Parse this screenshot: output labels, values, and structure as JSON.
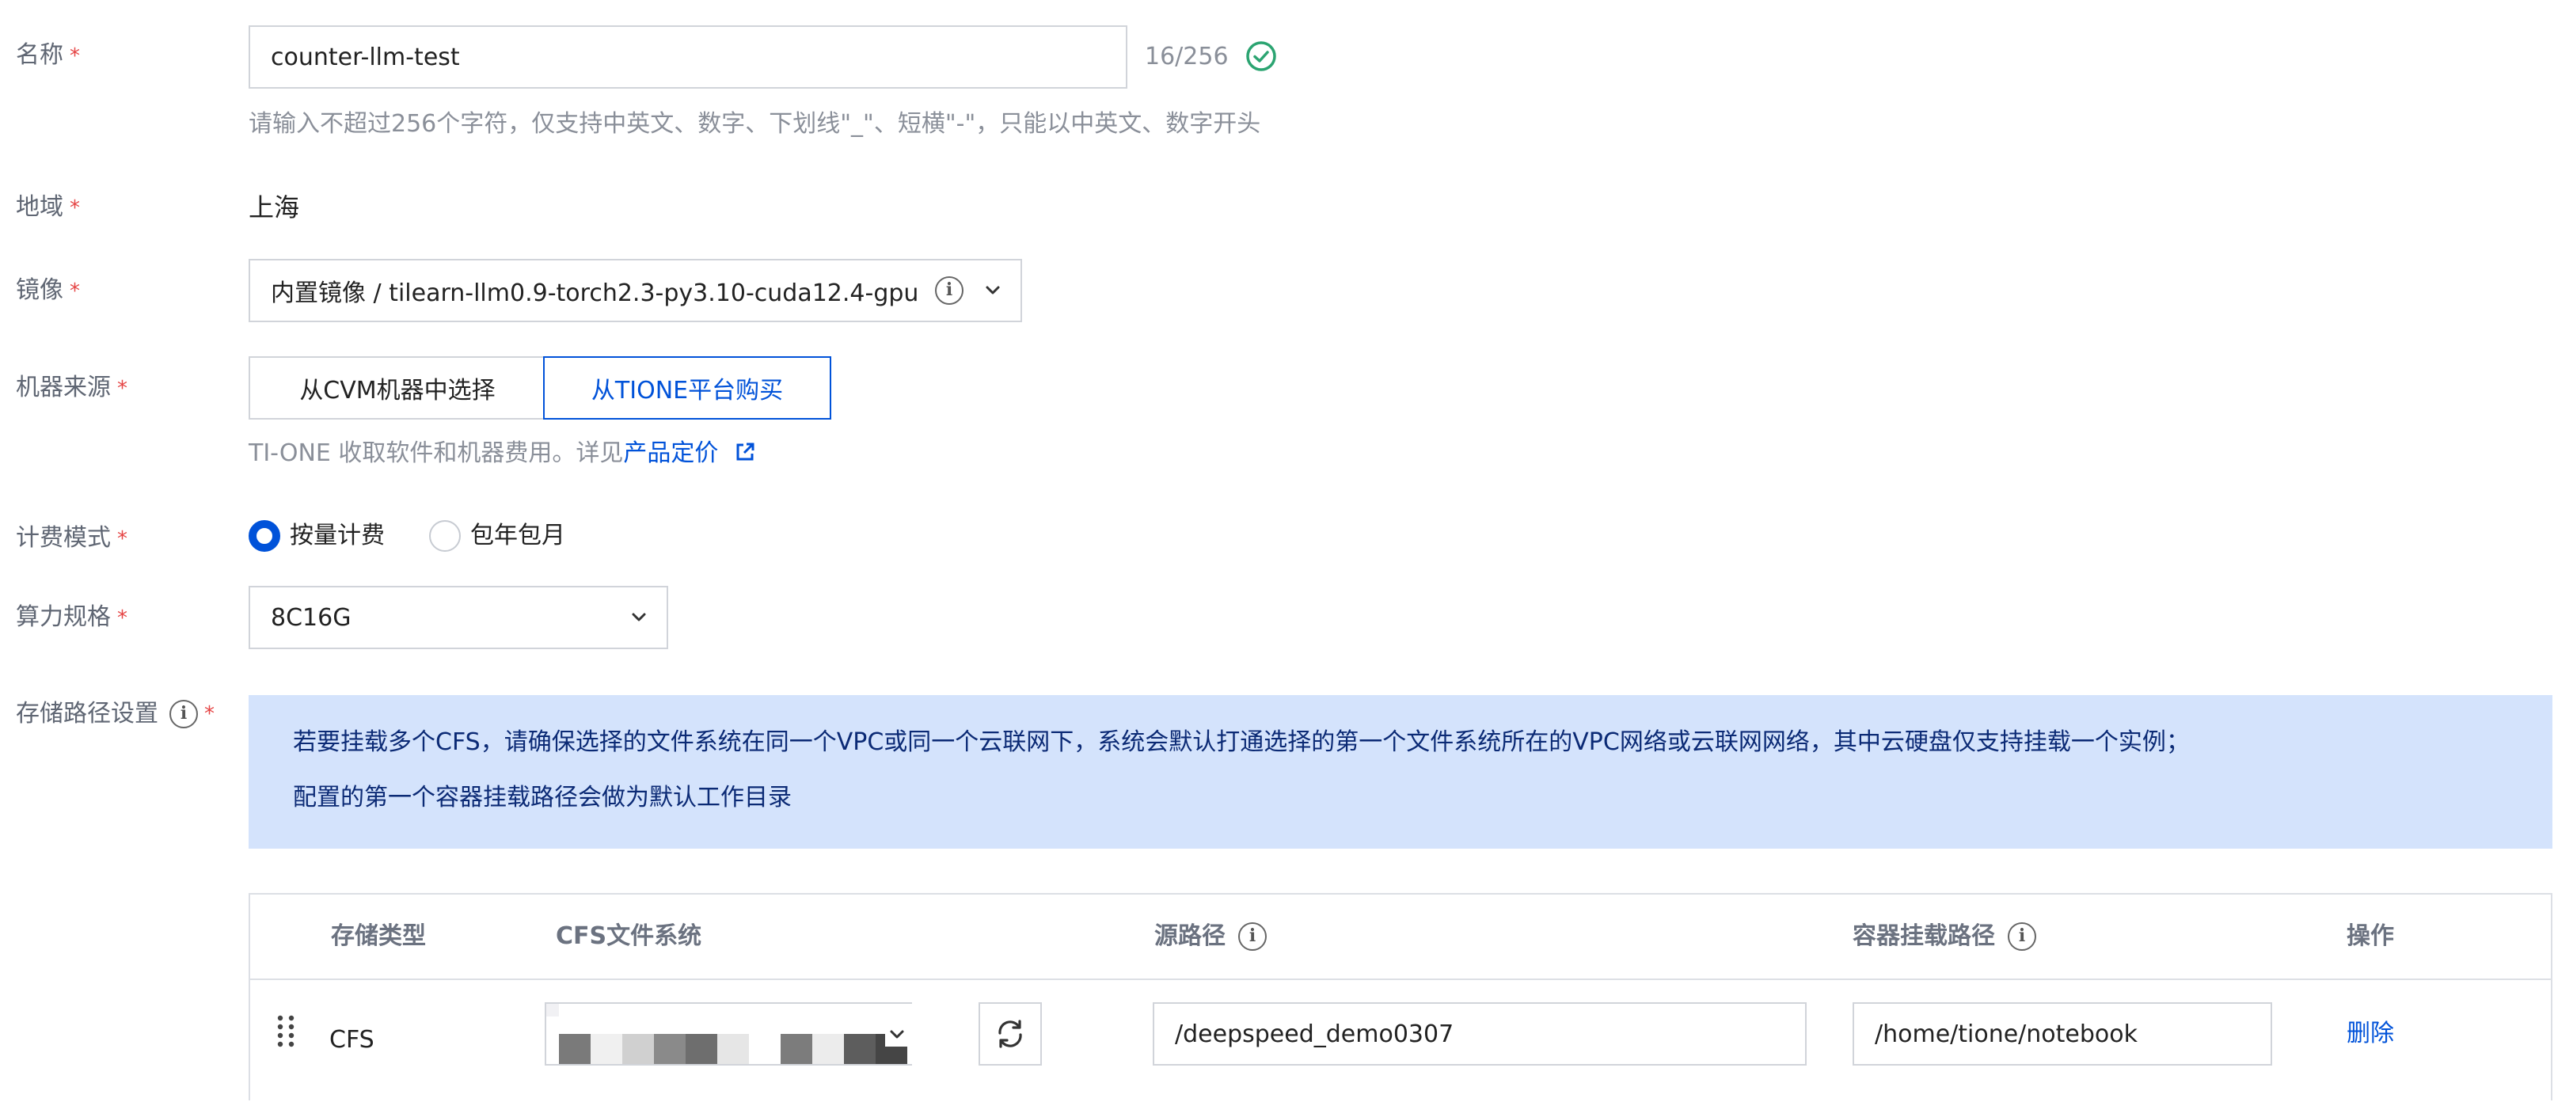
{
  "form": {
    "name": {
      "label": "名称",
      "required_mark": "*",
      "value": "counter-llm-test",
      "counter": "16/256",
      "hint": "请输入不超过256个字符，仅支持中英文、数字、下划线\"_\"、短横\"-\"，只能以中英文、数字开头"
    },
    "region": {
      "label": "地域",
      "required_mark": "*",
      "value": "上海"
    },
    "image": {
      "label": "镜像",
      "required_mark": "*",
      "value": "内置镜像 / tilearn-llm0.9-torch2.3-py3.10-cuda12.4-gpu"
    },
    "machine_source": {
      "label": "机器来源",
      "required_mark": "*",
      "options": [
        "从CVM机器中选择",
        "从TIONE平台购买"
      ],
      "selected": "从TIONE平台购买",
      "hint_prefix": "TI-ONE 收取软件和机器费用。详见",
      "hint_link": "产品定价"
    },
    "billing": {
      "label": "计费模式",
      "required_mark": "*",
      "options": [
        "按量计费",
        "包年包月"
      ],
      "selected": "按量计费"
    },
    "spec": {
      "label": "算力规格",
      "required_mark": "*",
      "value": "8C16G"
    },
    "storage": {
      "label": "存储路径设置",
      "required_mark": "*",
      "notice_line1": "若要挂载多个CFS，请确保选择的文件系统在同一个VPC或同一个云联网下，系统会默认打通选择的第一个文件系统所在的VPC网络或云联网网络，其中云硬盘仅支持挂载一个实例；",
      "notice_line2": "配置的第一个容器挂载路径会做为默认工作目录",
      "table": {
        "headers": [
          "存储类型",
          "CFS文件系统",
          "源路径",
          "容器挂载路径",
          "操作"
        ],
        "rows": [
          {
            "type": "CFS",
            "source_path": "/deepspeed_demo0307",
            "mount_path": "/home/tione/notebook",
            "action": "删除"
          }
        ]
      }
    }
  },
  "colors": {
    "primary": "#0052d9",
    "required": "#e54545",
    "success": "#2ba471",
    "notice_bg": "#d4e3fc",
    "notice_text": "#0b2a75"
  }
}
